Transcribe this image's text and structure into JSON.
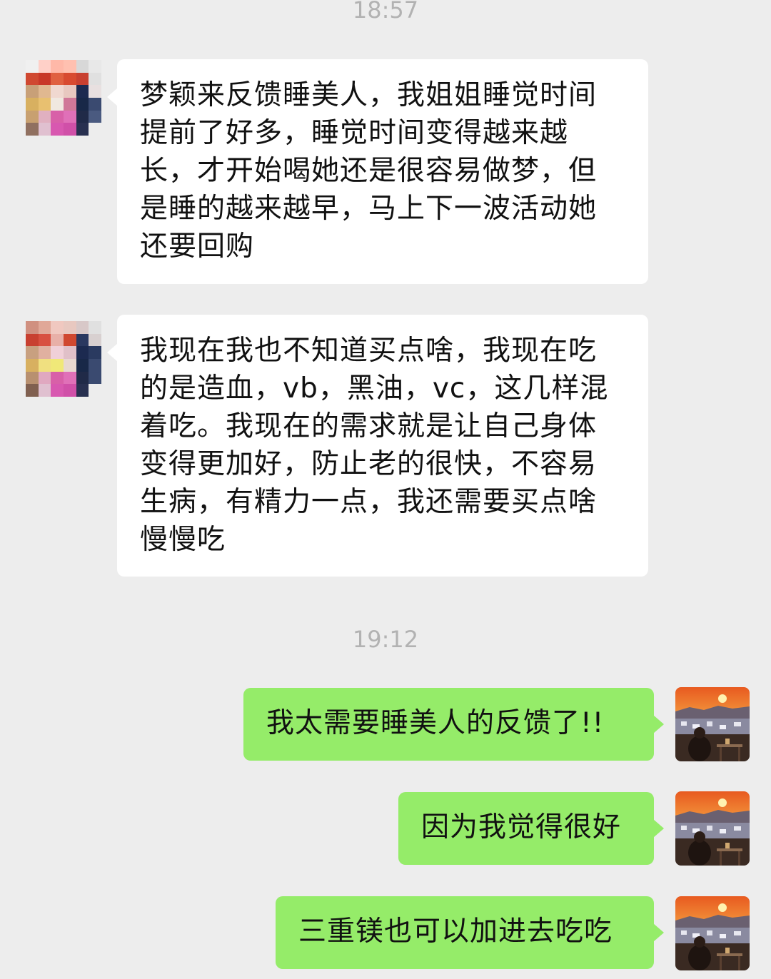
{
  "timestamps": [
    "18:57",
    "19:12"
  ],
  "incoming": [
    {
      "text": "梦颖来反馈睡美人，我姐姐睡觉时间\n提前了好多，睡觉时间变得越来越\n长，才开始喝她还是很容易做梦，但\n是睡的越来越早，马上下一波活动她\n还要回购"
    },
    {
      "text": "我现在我也不知道买点啥，我现在吃\n的是造血，vb，黑油，vc，这几样混\n着吃。我现在的需求就是让自己身体\n变得更加好，防止老的很快，不容易\n生病，有精力一点，我还需要买点啥\n慢慢吃"
    }
  ],
  "outgoing": [
    {
      "text": "我太需要睡美人的反馈了!!"
    },
    {
      "text": "因为我觉得很好"
    },
    {
      "text": "三重镁也可以加进去吃吃"
    }
  ],
  "icons": {
    "contact_avatar": "pixelated-avatar-icon",
    "my_avatar": "sunset-landscape-avatar-icon"
  },
  "colors": {
    "background": "#ededed",
    "incoming_bubble": "#ffffff",
    "outgoing_bubble": "#95ec69",
    "timestamp": "#b2b2b2"
  }
}
